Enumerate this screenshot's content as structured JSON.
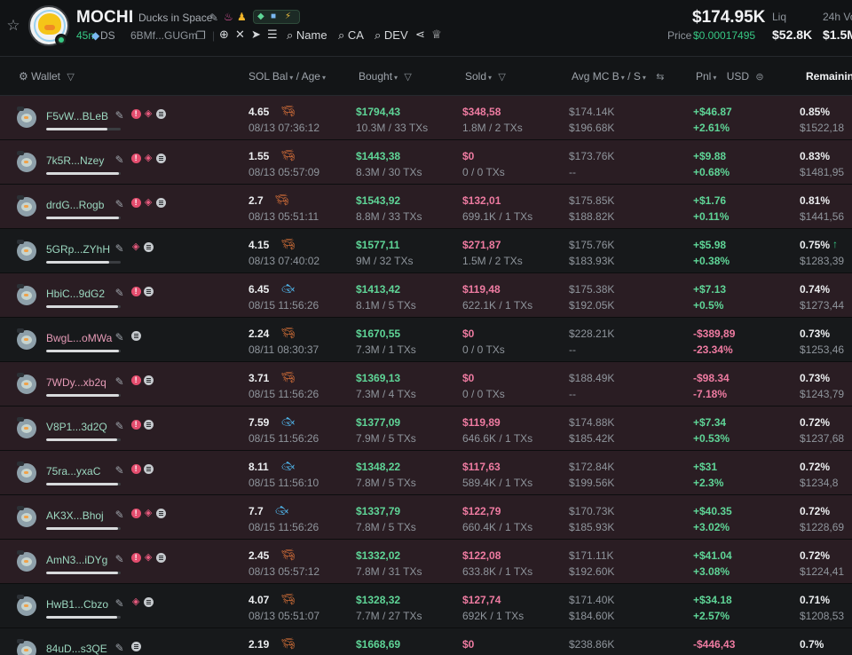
{
  "token": {
    "symbol": "MOCHI",
    "name": "Ducks in Space",
    "age": "45m",
    "ds_label": "DS",
    "address": "6BMf...GUGm",
    "links": {
      "name": "Name",
      "ca": "CA",
      "dev": "DEV"
    },
    "price_big": "$174.95K",
    "price_label": "Price",
    "price_value": "$0.00017495",
    "liq_label": "Liq",
    "liq_value": "$52.8K",
    "vol_label": "24h Vo",
    "vol_value": "$1.5M"
  },
  "columns": {
    "wallet": "Wallet",
    "sol_bal": "SOL Bal",
    "age": "Age",
    "bought": "Bought",
    "sold": "Sold",
    "avg_mc_b": "Avg MC B",
    "avg_mc_s": "S",
    "pnl": "Pnl",
    "usd": "USD",
    "remaining": "Remaining"
  },
  "colors": {
    "positive": "#5fd597",
    "negative": "#ee7ba1",
    "accent_green": "#37c884",
    "row_tint": "#2a1d23",
    "row_plain": "#17191b"
  },
  "rows": [
    {
      "wallet": "F5vW...BLeB",
      "pink": false,
      "badges": [
        "info",
        "layers",
        "menu"
      ],
      "bar": 0.82,
      "tint": true,
      "sol_bal": "4.65",
      "sol_icon": "shrimp",
      "time": "08/13 07:36:12",
      "bought": "$1794,43",
      "bought_tx": "10.3M / 33 TXs",
      "sold": "$348,58",
      "sold_tx": "1.8M / 2 TXs",
      "mc_b": "$174.14K",
      "mc_s": "$196.68K",
      "pnl": "+$46.87",
      "pnl_pct": "+2.61%",
      "pnl_pos": true,
      "remaining": "0.85%",
      "remaining_usd": "$1522,18",
      "up": false
    },
    {
      "wallet": "7k5R...Nzey",
      "pink": false,
      "badges": [
        "info",
        "layers",
        "menu"
      ],
      "bar": 0.98,
      "tint": true,
      "sol_bal": "1.55",
      "sol_icon": "shrimp",
      "time": "08/13 05:57:09",
      "bought": "$1443,38",
      "bought_tx": "8.3M / 30 TXs",
      "sold": "$0",
      "sold_tx": "0 / 0 TXs",
      "mc_b": "$173.76K",
      "mc_s": "--",
      "pnl": "+$9.88",
      "pnl_pct": "+0.68%",
      "pnl_pos": true,
      "remaining": "0.83%",
      "remaining_usd": "$1481,95",
      "up": false
    },
    {
      "wallet": "drdG...Rogb",
      "pink": false,
      "badges": [
        "info",
        "layers",
        "menu"
      ],
      "bar": 0.98,
      "tint": true,
      "sol_bal": "2.7",
      "sol_icon": "shrimp",
      "time": "08/13 05:51:11",
      "bought": "$1543,92",
      "bought_tx": "8.8M / 33 TXs",
      "sold": "$132,01",
      "sold_tx": "699.1K / 1 TXs",
      "mc_b": "$175.85K",
      "mc_s": "$188.82K",
      "pnl": "+$1.76",
      "pnl_pct": "+0.11%",
      "pnl_pos": true,
      "remaining": "0.81%",
      "remaining_usd": "$1441,56",
      "up": false
    },
    {
      "wallet": "5GRp...ZYhH",
      "pink": false,
      "badges": [
        "layers",
        "menu"
      ],
      "bar": 0.84,
      "tint": false,
      "sol_bal": "4.15",
      "sol_icon": "shrimp",
      "time": "08/13 07:40:02",
      "bought": "$1577,11",
      "bought_tx": "9M / 32 TXs",
      "sold": "$271,87",
      "sold_tx": "1.5M / 2 TXs",
      "mc_b": "$175.76K",
      "mc_s": "$183.93K",
      "pnl": "+$5.98",
      "pnl_pct": "+0.38%",
      "pnl_pos": true,
      "remaining": "0.75%",
      "remaining_usd": "$1283,39",
      "up": true
    },
    {
      "wallet": "HbiC...9dG2",
      "pink": false,
      "badges": [
        "info",
        "menu"
      ],
      "bar": 0.96,
      "tint": true,
      "sol_bal": "6.45",
      "sol_icon": "fish",
      "time": "08/15 11:56:26",
      "bought": "$1413,42",
      "bought_tx": "8.1M / 5 TXs",
      "sold": "$119,48",
      "sold_tx": "622.1K / 1 TXs",
      "mc_b": "$175.38K",
      "mc_s": "$192.05K",
      "pnl": "+$7.13",
      "pnl_pct": "+0.5%",
      "pnl_pos": true,
      "remaining": "0.74%",
      "remaining_usd": "$1273,44",
      "up": false
    },
    {
      "wallet": "BwgL...oMWa",
      "pink": true,
      "badges": [
        "menu"
      ],
      "bar": 0.98,
      "tint": false,
      "sol_bal": "2.24",
      "sol_icon": "shrimp",
      "time": "08/11 08:30:37",
      "bought": "$1670,55",
      "bought_tx": "7.3M / 1 TXs",
      "sold": "$0",
      "sold_tx": "0 / 0 TXs",
      "mc_b": "$228.21K",
      "mc_s": "--",
      "pnl": "-$389,89",
      "pnl_pct": "-23.34%",
      "pnl_pos": false,
      "remaining": "0.73%",
      "remaining_usd": "$1253,46",
      "up": false
    },
    {
      "wallet": "7WDy...xb2q",
      "pink": true,
      "badges": [
        "info",
        "menu"
      ],
      "bar": 0.98,
      "tint": true,
      "sol_bal": "3.71",
      "sol_icon": "shrimp",
      "time": "08/15 11:56:26",
      "bought": "$1369,13",
      "bought_tx": "7.3M / 4 TXs",
      "sold": "$0",
      "sold_tx": "0 / 0 TXs",
      "mc_b": "$188.49K",
      "mc_s": "--",
      "pnl": "-$98.34",
      "pnl_pct": "-7.18%",
      "pnl_pos": false,
      "remaining": "0.73%",
      "remaining_usd": "$1243,79",
      "up": false
    },
    {
      "wallet": "V8P1...3d2Q",
      "pink": false,
      "badges": [
        "info",
        "menu"
      ],
      "bar": 0.95,
      "tint": true,
      "sol_bal": "7.59",
      "sol_icon": "fish",
      "time": "08/15 11:56:26",
      "bought": "$1377,09",
      "bought_tx": "7.9M / 5 TXs",
      "sold": "$119,89",
      "sold_tx": "646.6K / 1 TXs",
      "mc_b": "$174.88K",
      "mc_s": "$185.42K",
      "pnl": "+$7.34",
      "pnl_pct": "+0.53%",
      "pnl_pos": true,
      "remaining": "0.72%",
      "remaining_usd": "$1237,68",
      "up": false
    },
    {
      "wallet": "75ra...yxaC",
      "pink": false,
      "badges": [
        "info",
        "menu"
      ],
      "bar": 0.96,
      "tint": true,
      "sol_bal": "8.11",
      "sol_icon": "fish",
      "time": "08/15 11:56:10",
      "bought": "$1348,22",
      "bought_tx": "7.8M / 5 TXs",
      "sold": "$117,63",
      "sold_tx": "589.4K / 1 TXs",
      "mc_b": "$172.84K",
      "mc_s": "$199.56K",
      "pnl": "+$31",
      "pnl_pct": "+2.3%",
      "pnl_pos": true,
      "remaining": "0.72%",
      "remaining_usd": "$1234,8",
      "up": false
    },
    {
      "wallet": "AK3X...Bhoj",
      "pink": false,
      "badges": [
        "info",
        "layers",
        "menu"
      ],
      "bar": 0.96,
      "tint": true,
      "sol_bal": "7.7",
      "sol_icon": "fish",
      "time": "08/15 11:56:26",
      "bought": "$1337,79",
      "bought_tx": "7.8M / 5 TXs",
      "sold": "$122,79",
      "sold_tx": "660.4K / 1 TXs",
      "mc_b": "$170.73K",
      "mc_s": "$185.93K",
      "pnl": "+$40.35",
      "pnl_pct": "+3.02%",
      "pnl_pos": true,
      "remaining": "0.72%",
      "remaining_usd": "$1228,69",
      "up": false
    },
    {
      "wallet": "AmN3...iDYg",
      "pink": false,
      "badges": [
        "info",
        "layers",
        "menu"
      ],
      "bar": 0.96,
      "tint": true,
      "sol_bal": "2.45",
      "sol_icon": "shrimp",
      "time": "08/13 05:57:12",
      "bought": "$1332,02",
      "bought_tx": "7.8M / 31 TXs",
      "sold": "$122,08",
      "sold_tx": "633.8K / 1 TXs",
      "mc_b": "$171.11K",
      "mc_s": "$192.60K",
      "pnl": "+$41.04",
      "pnl_pct": "+3.08%",
      "pnl_pos": true,
      "remaining": "0.72%",
      "remaining_usd": "$1224,41",
      "up": false
    },
    {
      "wallet": "HwB1...Cbzo",
      "pink": false,
      "badges": [
        "layers",
        "menu"
      ],
      "bar": 0.95,
      "tint": false,
      "sol_bal": "4.07",
      "sol_icon": "shrimp",
      "time": "08/13 05:51:07",
      "bought": "$1328,32",
      "bought_tx": "7.7M / 27 TXs",
      "sold": "$127,74",
      "sold_tx": "692K / 1 TXs",
      "mc_b": "$171.40K",
      "mc_s": "$184.60K",
      "pnl": "+$34.18",
      "pnl_pct": "+2.57%",
      "pnl_pos": true,
      "remaining": "0.71%",
      "remaining_usd": "$1208,53",
      "up": false
    },
    {
      "wallet": "84uD...s3QE",
      "pink": false,
      "badges": [
        "menu"
      ],
      "bar": 0.95,
      "tint": false,
      "sol_bal": "2.19",
      "sol_icon": "shrimp",
      "time": "",
      "bought": "$1668,69",
      "bought_tx": "",
      "sold": "$0",
      "sold_tx": "",
      "mc_b": "$238.86K",
      "mc_s": "",
      "pnl": "-$446,43",
      "pnl_pct": "",
      "pnl_pos": false,
      "remaining": "0.7%",
      "remaining_usd": "",
      "up": false
    }
  ]
}
